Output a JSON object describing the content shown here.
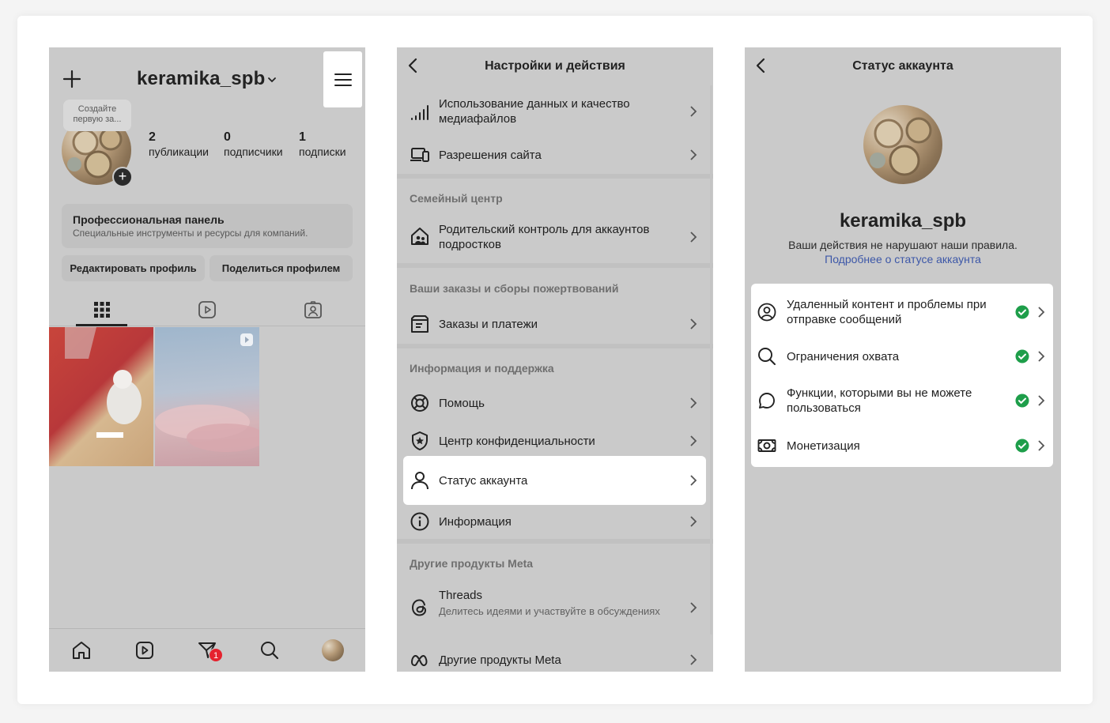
{
  "profile": {
    "username": "keramika_spb",
    "bubble": "Создайте первую за...",
    "stats": [
      {
        "count": "2",
        "label": "публикации"
      },
      {
        "count": "0",
        "label": "подписчики"
      },
      {
        "count": "1",
        "label": "подписки"
      }
    ],
    "pro_panel_title": "Профессиональная панель",
    "pro_panel_subtitle": "Специальные инструменты и ресурсы для компаний.",
    "edit_button": "Редактировать профиль",
    "share_button": "Поделиться профилем",
    "notification_badge": "1"
  },
  "settings": {
    "title": "Настройки и действия",
    "rows": {
      "data_usage": "Использование данных и качество медиафайлов",
      "site_permissions": "Разрешения сайта",
      "parental": "Родительский контроль для аккаунтов подростков",
      "orders": "Заказы и платежи",
      "help": "Помощь",
      "privacy": "Центр конфиденциальности",
      "account_status": "Статус аккаунта",
      "info": "Информация",
      "threads": "Threads",
      "threads_sub": "Делитесь идеями и участвуйте в обсуждениях",
      "other_meta": "Другие продукты Meta"
    },
    "sections": {
      "family": "Семейный центр",
      "orders": "Ваши заказы и сборы пожертвований",
      "support": "Информация и поддержка",
      "meta": "Другие продукты Meta"
    }
  },
  "status": {
    "title": "Статус аккаунта",
    "username": "keramika_spb",
    "description": "Ваши действия не нарушают наши правила.",
    "link": "Подробнее о статусе аккаунта",
    "items": [
      "Удаленный контент и проблемы при отправке сообщений",
      "Ограничения охвата",
      "Функции, которыми вы не можете пользоваться",
      "Монетизация"
    ]
  },
  "colors": {
    "check": "#1e9e4a",
    "link": "#3c57a8",
    "badge": "#e5222e"
  }
}
